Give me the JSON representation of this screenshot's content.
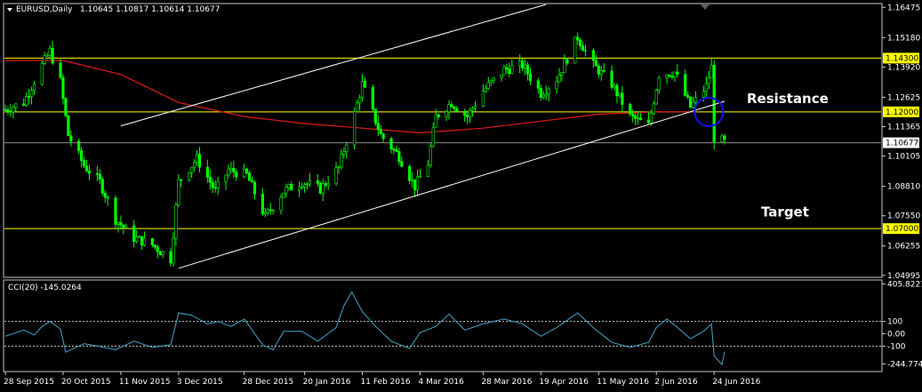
{
  "header": {
    "symbol_label": "EURUSD,Daily",
    "ohlc": "1.10645 1.10817 1.10614 1.10677"
  },
  "indicator_label": "CCI(20) -145.0264",
  "chart_data": [
    {
      "type": "candlestick",
      "pane": "main",
      "symbol": "EURUSD",
      "timeframe": "Daily",
      "ylim": [
        1.0495,
        1.166
      ],
      "y_tick_labels": [
        "1.16475",
        "1.15180",
        "1.13920",
        "1.12625",
        "1.11365",
        "1.10105",
        "1.08810",
        "1.07550",
        "1.06255",
        "1.04995"
      ],
      "y_ticks": [
        1.16475,
        1.1518,
        1.1392,
        1.12625,
        1.11365,
        1.10105,
        1.0881,
        1.0755,
        1.06255,
        1.04995
      ],
      "x_tick_labels": [
        "28 Sep 2015",
        "20 Oct 2015",
        "11 Nov 2015",
        "3 Dec 2015",
        "28 Dec 2015",
        "20 Jan 2016",
        "11 Feb 2016",
        "4 Mar 2016",
        "28 Mar 2016",
        "19 Apr 2016",
        "11 May 2016",
        "2 Jun 2016",
        "24 Jun 2016"
      ],
      "x_range": [
        "2015-09-28",
        "2016-06-28"
      ],
      "close_path": [
        [
          "2015-09-28",
          1.121
        ],
        [
          "2015-10-05",
          1.124
        ],
        [
          "2015-10-12",
          1.14
        ],
        [
          "2015-10-15",
          1.146
        ],
        [
          "2015-10-19",
          1.133
        ],
        [
          "2015-10-22",
          1.11
        ],
        [
          "2015-10-28",
          1.097
        ],
        [
          "2015-11-03",
          1.09
        ],
        [
          "2015-11-09",
          1.074
        ],
        [
          "2015-11-16",
          1.066
        ],
        [
          "2015-11-23",
          1.063
        ],
        [
          "2015-11-30",
          1.057
        ],
        [
          "2015-12-03",
          1.09
        ],
        [
          "2015-12-10",
          1.1
        ],
        [
          "2015-12-17",
          1.086
        ],
        [
          "2015-12-22",
          1.095
        ],
        [
          "2015-12-29",
          1.093
        ],
        [
          "2016-01-05",
          1.075
        ],
        [
          "2016-01-12",
          1.086
        ],
        [
          "2016-01-19",
          1.09
        ],
        [
          "2016-01-26",
          1.087
        ],
        [
          "2016-02-02",
          1.096
        ],
        [
          "2016-02-08",
          1.119
        ],
        [
          "2016-02-11",
          1.132
        ],
        [
          "2016-02-18",
          1.11
        ],
        [
          "2016-02-25",
          1.101
        ],
        [
          "2016-03-02",
          1.088
        ],
        [
          "2016-03-07",
          1.098
        ],
        [
          "2016-03-10",
          1.118
        ],
        [
          "2016-03-16",
          1.124
        ],
        [
          "2016-03-22",
          1.118
        ],
        [
          "2016-03-28",
          1.129
        ],
        [
          "2016-04-05",
          1.138
        ],
        [
          "2016-04-12",
          1.14
        ],
        [
          "2016-04-19",
          1.128
        ],
        [
          "2016-04-25",
          1.134
        ],
        [
          "2016-05-03",
          1.152
        ],
        [
          "2016-05-09",
          1.14
        ],
        [
          "2016-05-16",
          1.132
        ],
        [
          "2016-05-23",
          1.118
        ],
        [
          "2016-05-30",
          1.114
        ],
        [
          "2016-06-03",
          1.136
        ],
        [
          "2016-06-09",
          1.137
        ],
        [
          "2016-06-15",
          1.122
        ],
        [
          "2016-06-21",
          1.131
        ],
        [
          "2016-06-23",
          1.139
        ],
        [
          "2016-06-24",
          1.109
        ],
        [
          "2016-06-28",
          1.107
        ]
      ],
      "moving_average_path": [
        [
          "2015-09-28",
          1.142
        ],
        [
          "2015-10-20",
          1.142
        ],
        [
          "2015-11-11",
          1.136
        ],
        [
          "2015-12-03",
          1.124
        ],
        [
          "2015-12-28",
          1.118
        ],
        [
          "2016-01-20",
          1.115
        ],
        [
          "2016-02-11",
          1.113
        ],
        [
          "2016-03-04",
          1.111
        ],
        [
          "2016-03-28",
          1.113
        ],
        [
          "2016-04-19",
          1.116
        ],
        [
          "2016-05-11",
          1.119
        ],
        [
          "2016-06-02",
          1.12
        ],
        [
          "2016-06-17",
          1.12
        ]
      ],
      "horizontal_levels": [
        {
          "value": 1.143,
          "label": "1.14300",
          "color": "#ffff00"
        },
        {
          "value": 1.12,
          "label": "1.12000",
          "color": "#ffff00"
        },
        {
          "value": 1.07,
          "label": "1.07000",
          "color": "#ffff00"
        }
      ],
      "current_price": {
        "value": 1.10677,
        "label": "1.10677"
      },
      "trendlines": [
        {
          "from": [
            "2015-12-03",
            1.053
          ],
          "to": [
            "2016-06-28",
            1.1245
          ]
        },
        {
          "from": [
            "2015-11-11",
            1.114
          ],
          "to": [
            "2016-04-21",
            1.166
          ]
        }
      ],
      "annotations": [
        {
          "text": "Resistance",
          "at": [
            "2016-06-28",
            1.121
          ]
        },
        {
          "text": "Target",
          "at": [
            "2016-06-28",
            1.0725
          ]
        }
      ],
      "circle_marker": {
        "at": [
          "2016-06-22",
          1.12
        ]
      },
      "colors": {
        "candles": "#00ff00",
        "moving_average": "#dd1a1a",
        "levels": "#ffff00",
        "trendlines": "#ffffff",
        "circle": "#1010ee"
      }
    },
    {
      "type": "line",
      "pane": "indicator",
      "name": "CCI(20)",
      "last_value": -145.0264,
      "ylim": [
        -300,
        430
      ],
      "y_tick_labels": [
        "405.8221",
        "100",
        "0.00",
        "-100",
        "-244.7743"
      ],
      "y_ticks": [
        405.8221,
        100,
        0,
        -100,
        -244.7743
      ],
      "levels": [
        100,
        -100
      ],
      "points": [
        [
          "2015-09-28",
          -20
        ],
        [
          "2015-10-05",
          30
        ],
        [
          "2015-10-09",
          -10
        ],
        [
          "2015-10-12",
          60
        ],
        [
          "2015-10-15",
          100
        ],
        [
          "2015-10-19",
          40
        ],
        [
          "2015-10-21",
          -150
        ],
        [
          "2015-10-28",
          -80
        ],
        [
          "2015-11-02",
          -100
        ],
        [
          "2015-11-09",
          -130
        ],
        [
          "2015-11-16",
          -60
        ],
        [
          "2015-11-23",
          -110
        ],
        [
          "2015-11-30",
          -90
        ],
        [
          "2015-12-03",
          170
        ],
        [
          "2015-12-08",
          150
        ],
        [
          "2015-12-14",
          80
        ],
        [
          "2015-12-18",
          100
        ],
        [
          "2015-12-23",
          60
        ],
        [
          "2015-12-28",
          120
        ],
        [
          "2016-01-04",
          -90
        ],
        [
          "2016-01-08",
          -130
        ],
        [
          "2016-01-12",
          20
        ],
        [
          "2016-01-19",
          20
        ],
        [
          "2016-01-25",
          -60
        ],
        [
          "2016-02-01",
          50
        ],
        [
          "2016-02-04",
          230
        ],
        [
          "2016-02-07",
          340
        ],
        [
          "2016-02-11",
          180
        ],
        [
          "2016-02-16",
          60
        ],
        [
          "2016-02-22",
          -60
        ],
        [
          "2016-02-29",
          -120
        ],
        [
          "2016-03-04",
          10
        ],
        [
          "2016-03-10",
          60
        ],
        [
          "2016-03-15",
          160
        ],
        [
          "2016-03-21",
          30
        ],
        [
          "2016-03-28",
          80
        ],
        [
          "2016-04-05",
          120
        ],
        [
          "2016-04-12",
          80
        ],
        [
          "2016-04-19",
          -20
        ],
        [
          "2016-04-25",
          50
        ],
        [
          "2016-05-03",
          170
        ],
        [
          "2016-05-09",
          50
        ],
        [
          "2016-05-16",
          -70
        ],
        [
          "2016-05-23",
          -110
        ],
        [
          "2016-05-30",
          -70
        ],
        [
          "2016-06-02",
          50
        ],
        [
          "2016-06-06",
          120
        ],
        [
          "2016-06-09",
          70
        ],
        [
          "2016-06-15",
          -40
        ],
        [
          "2016-06-20",
          20
        ],
        [
          "2016-06-23",
          80
        ],
        [
          "2016-06-24",
          -180
        ],
        [
          "2016-06-27",
          -250
        ],
        [
          "2016-06-28",
          -145
        ]
      ],
      "colors": {
        "line": "#42a8c8",
        "levels": "#c8c8c8"
      }
    }
  ]
}
